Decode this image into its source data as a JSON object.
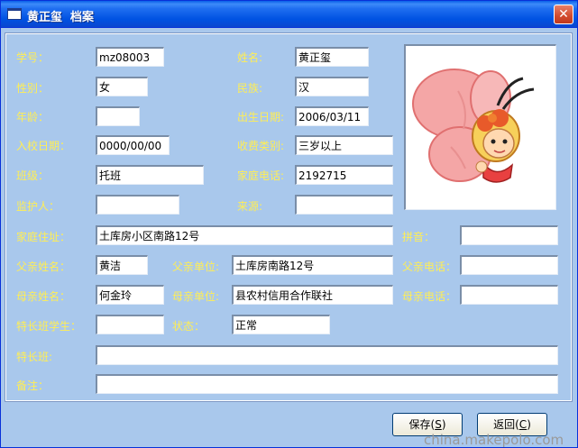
{
  "window": {
    "title": "黄正玺  档案",
    "close_glyph": "✕"
  },
  "form": {
    "student_id": {
      "label": "学号：",
      "value": "mz08003"
    },
    "name": {
      "label": "姓名:",
      "value": "黄正玺"
    },
    "gender": {
      "label": "性别：",
      "value": "女"
    },
    "ethnicity": {
      "label": "民族:",
      "value": "汉"
    },
    "age": {
      "label": "年龄：",
      "value": ""
    },
    "birth_date": {
      "label": "出生日期:",
      "value": "2006/03/11"
    },
    "enroll_date": {
      "label": "入校日期：",
      "value": "0000/00/00"
    },
    "fee_category": {
      "label": "收费类别:",
      "value": "三岁以上"
    },
    "class": {
      "label": "班级：",
      "value": "托班"
    },
    "home_phone": {
      "label": "家庭电话:",
      "value": "2192715"
    },
    "guardian": {
      "label": "监护人：",
      "value": ""
    },
    "source": {
      "label": "来源:",
      "value": ""
    },
    "address": {
      "label": "家庭住址：",
      "value": "土库房小区南路12号"
    },
    "pinyin": {
      "label": "拼音：",
      "value": ""
    },
    "father_name": {
      "label": "父亲姓名：",
      "value": "黄洁"
    },
    "father_work": {
      "label": "父亲单位:",
      "value": "土库房南路12号"
    },
    "father_phone": {
      "label": "父亲电话：",
      "value": ""
    },
    "mother_name": {
      "label": "母亲姓名：",
      "value": "何金玲"
    },
    "mother_work": {
      "label": "母亲单位:",
      "value": "县农村信用合作联社"
    },
    "mother_phone": {
      "label": "母亲电话：",
      "value": ""
    },
    "special_student": {
      "label": "特长班学生：",
      "value": ""
    },
    "status": {
      "label": "状态：",
      "value": "正常"
    },
    "special_class": {
      "label": "特长班:",
      "value": ""
    },
    "remarks": {
      "label": "备注：",
      "value": ""
    }
  },
  "buttons": {
    "save": {
      "text": "保存(",
      "key": "S",
      "end": ")"
    },
    "back": {
      "text": "返回(",
      "key": "C",
      "end": ")"
    }
  },
  "watermark": "china.makepolo.com",
  "colors": {
    "label": "#ffee55",
    "panel": "#a9c8ec",
    "titlebar": "#0052e2"
  }
}
